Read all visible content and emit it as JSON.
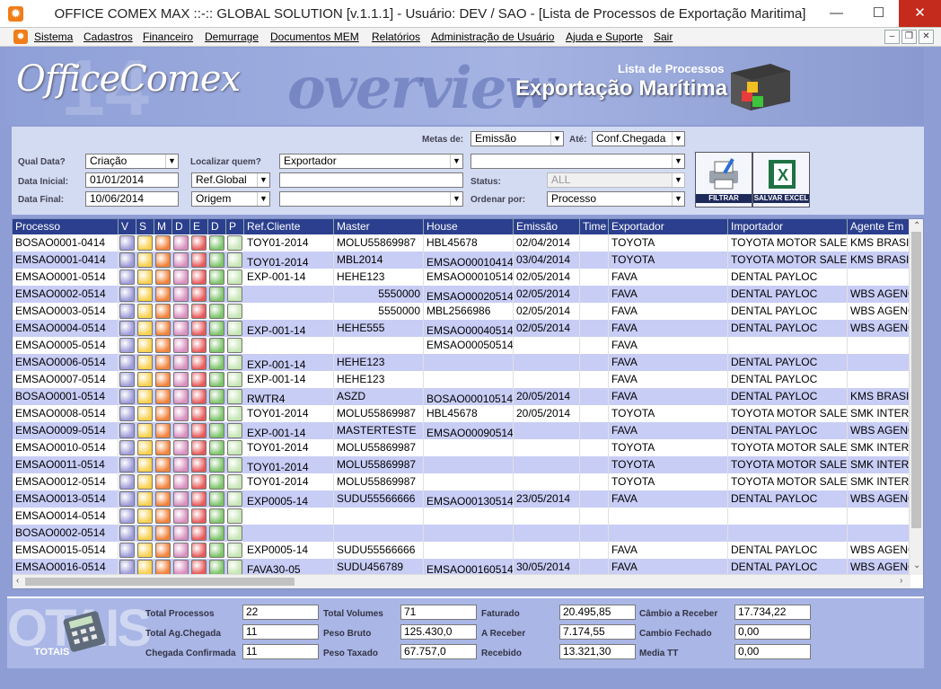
{
  "window": {
    "title": "OFFICE COMEX MAX ::-:: GLOBAL SOLUTION [v.1.1.1] - Usuário: DEV / SAO - [Lista de Processos de Exportação Maritima]"
  },
  "menu": [
    "Sistema",
    "Cadastros",
    "Financeiro",
    "Demurrage",
    "Documentos MEM",
    "Relatórios",
    "Administração de Usuário",
    "Ajuda e Suporte",
    "Sair"
  ],
  "banner": {
    "logo": "OfficeComex",
    "number": "14",
    "overview": "overview",
    "subtitle": "Lista de Processos",
    "title": "Exportação Marítima"
  },
  "filters": {
    "metas_label": "Metas de:",
    "metas_value": "Emissão",
    "ate_label": "Até:",
    "ate_value": "Conf.Chegada",
    "qual_data_label": "Qual Data?",
    "qual_data_value": "Criação",
    "data_inicial_label": "Data Inicial:",
    "data_inicial_value": "01/01/2014",
    "data_final_label": "Data Final:",
    "data_final_value": "10/06/2014",
    "localizar_label": "Localizar quem?",
    "localizar_value": "Exportador",
    "ref_value": "Ref.Global",
    "origem_value": "Origem",
    "status_label": "Status:",
    "status_value": "ALL",
    "ordenar_label": "Ordenar por:",
    "ordenar_value": "Processo",
    "filtrar_label": "FILTRAR",
    "excel_label": "SALVAR EXCEL"
  },
  "grid": {
    "columns": [
      "Processo",
      "V",
      "S",
      "M",
      "D",
      "E",
      "D",
      "P",
      "Ref.Cliente",
      "Master",
      "House",
      "Emissão",
      "Time",
      "Exportador",
      "Importador",
      "Agente Em"
    ],
    "flag_colors": [
      "#9d9bd8",
      "#f8d04a",
      "#f3823a",
      "#d98fbf",
      "#e85a5a",
      "#7cc46a",
      "#c6e6b4"
    ],
    "rows": [
      {
        "processo": "BOSAO0001-0414",
        "ref": "TOY01-2014",
        "master": "MOLU55869987",
        "house": "HBL45678",
        "emissao": "02/04/2014",
        "exportador": "TOYOTA",
        "importador": "TOYOTA MOTOR SALES",
        "agente": "KMS BRASIL"
      },
      {
        "processo": "EMSAO0001-0414",
        "ref": "TOY01-2014",
        "master": "MBL2014",
        "house": "EMSAO00010414",
        "emissao": "03/04/2014",
        "exportador": "TOYOTA",
        "importador": "TOYOTA MOTOR SALES",
        "agente": "KMS BRASIL"
      },
      {
        "processo": "EMSAO0001-0514",
        "ref": "EXP-001-14",
        "master": "HEHE123",
        "house": "EMSAO00010514",
        "emissao": "02/05/2014",
        "exportador": "FAVA",
        "importador": "DENTAL PAYLOC",
        "agente": ""
      },
      {
        "processo": "EMSAO0002-0514",
        "ref": "",
        "master": "5550000",
        "house": "EMSAO00020514",
        "emissao": "02/05/2014",
        "exportador": "FAVA",
        "importador": "DENTAL PAYLOC",
        "agente": "WBS AGENCIA"
      },
      {
        "processo": "EMSAO0003-0514",
        "ref": "",
        "master": "5550000",
        "house": "MBL2566986",
        "emissao": "02/05/2014",
        "exportador": "FAVA",
        "importador": "DENTAL PAYLOC",
        "agente": "WBS AGENCIA"
      },
      {
        "processo": "EMSAO0004-0514",
        "ref": "EXP-001-14",
        "master": "HEHE555",
        "house": "EMSAO00040514",
        "emissao": "02/05/2014",
        "exportador": "FAVA",
        "importador": "DENTAL PAYLOC",
        "agente": "WBS AGENCIA"
      },
      {
        "processo": "EMSAO0005-0514",
        "ref": "",
        "master": "",
        "house": "EMSAO00050514",
        "emissao": "",
        "exportador": "FAVA",
        "importador": "",
        "agente": ""
      },
      {
        "processo": "EMSAO0006-0514",
        "ref": "EXP-001-14",
        "master": "HEHE123",
        "house": "",
        "emissao": "",
        "exportador": "FAVA",
        "importador": "DENTAL PAYLOC",
        "agente": ""
      },
      {
        "processo": "EMSAO0007-0514",
        "ref": "EXP-001-14",
        "master": "HEHE123",
        "house": "",
        "emissao": "",
        "exportador": "FAVA",
        "importador": "DENTAL PAYLOC",
        "agente": ""
      },
      {
        "processo": "BOSAO0001-0514",
        "ref": "RWTR4",
        "master": "ASZD",
        "house": "BOSAO00010514",
        "emissao": "20/05/2014",
        "exportador": "FAVA",
        "importador": "DENTAL PAYLOC",
        "agente": "KMS BRASIL"
      },
      {
        "processo": "EMSAO0008-0514",
        "ref": "TOY01-2014",
        "master": "MOLU55869987",
        "house": "HBL45678",
        "emissao": "20/05/2014",
        "exportador": "TOYOTA",
        "importador": "TOYOTA MOTOR SALES",
        "agente": "SMK INTER"
      },
      {
        "processo": "EMSAO0009-0514",
        "ref": "EXP-001-14",
        "master": "MASTERTESTE",
        "house": "EMSAO00090514",
        "emissao": "",
        "exportador": "FAVA",
        "importador": "DENTAL PAYLOC",
        "agente": "WBS AGENCIA"
      },
      {
        "processo": "EMSAO0010-0514",
        "ref": "TOY01-2014",
        "master": "MOLU55869987",
        "house": "",
        "emissao": "",
        "exportador": "TOYOTA",
        "importador": "TOYOTA MOTOR SALES",
        "agente": "SMK INTER"
      },
      {
        "processo": "EMSAO0011-0514",
        "ref": "TOY01-2014",
        "master": "MOLU55869987",
        "house": "",
        "emissao": "",
        "exportador": "TOYOTA",
        "importador": "TOYOTA MOTOR SALES",
        "agente": "SMK INTER"
      },
      {
        "processo": "EMSAO0012-0514",
        "ref": "TOY01-2014",
        "master": "MOLU55869987",
        "house": "",
        "emissao": "",
        "exportador": "TOYOTA",
        "importador": "TOYOTA MOTOR SALES",
        "agente": "SMK INTER"
      },
      {
        "processo": "EMSAO0013-0514",
        "ref": "EXP0005-14",
        "master": "SUDU55566666",
        "house": "EMSAO00130514",
        "emissao": "23/05/2014",
        "exportador": "FAVA",
        "importador": "DENTAL PAYLOC",
        "agente": "WBS AGENCIA"
      },
      {
        "processo": "EMSAO0014-0514",
        "ref": "",
        "master": "",
        "house": "",
        "emissao": "",
        "exportador": "",
        "importador": "",
        "agente": ""
      },
      {
        "processo": "BOSAO0002-0514",
        "ref": "",
        "master": "",
        "house": "",
        "emissao": "",
        "exportador": "",
        "importador": "",
        "agente": ""
      },
      {
        "processo": "EMSAO0015-0514",
        "ref": "EXP0005-14",
        "master": "SUDU55566666",
        "house": "",
        "emissao": "",
        "exportador": "FAVA",
        "importador": "DENTAL PAYLOC",
        "agente": "WBS AGENCIA"
      },
      {
        "processo": "EMSAO0016-0514",
        "ref": "FAVA30-05",
        "master": "SUDU456789",
        "house": "EMSAO00160514",
        "emissao": "30/05/2014",
        "exportador": "FAVA",
        "importador": "DENTAL PAYLOC",
        "agente": "WBS AGENCIA"
      }
    ]
  },
  "totals": {
    "watermark": "OTAIS",
    "caption": "TOTAIS",
    "total_processos_label": "Total Processos",
    "total_processos": "22",
    "total_ag_chegada_label": "Total Ag.Chegada",
    "total_ag_chegada": "11",
    "chegada_confirmada_label": "Chegada Confirmada",
    "chegada_confirmada": "11",
    "total_volumes_label": "Total Volumes",
    "total_volumes": "71",
    "peso_bruto_label": "Peso Bruto",
    "peso_bruto": "125.430,0",
    "peso_taxado_label": "Peso Taxado",
    "peso_taxado": "67.757,0",
    "faturado_label": "Faturado",
    "faturado": "20.495,85",
    "a_receber_label": "A Receber",
    "a_receber": "7.174,55",
    "recebido_label": "Recebido",
    "recebido": "13.321,30",
    "cambio_receber_label": "Câmbio a Receber",
    "cambio_receber": "17.734,22",
    "cambio_fechado_label": "Cambio Fechado",
    "cambio_fechado": "0,00",
    "media_tt_label": "Media TT",
    "media_tt": "0,00"
  }
}
